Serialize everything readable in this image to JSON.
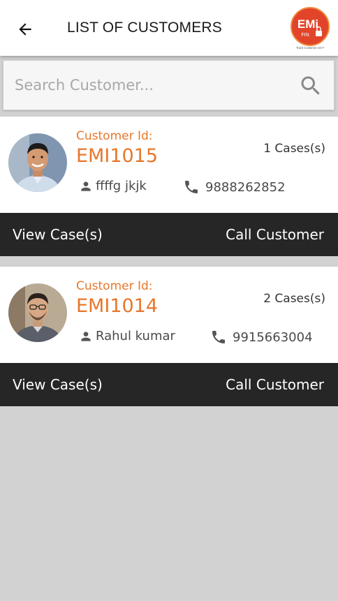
{
  "header": {
    "title": "LIST OF CUSTOMERS",
    "logo_text": "EMi",
    "logo_sub": "FIN",
    "logo_tagline": "Track Customer 24×7"
  },
  "search": {
    "placeholder": "Search Customer...",
    "value": ""
  },
  "colors": {
    "accent": "#e8772b",
    "action_bar": "#262626",
    "background": "#d2d2d2"
  },
  "customers": [
    {
      "id_label": "Customer Id:",
      "id": "EMI1015",
      "cases": "1 Cases(s)",
      "name": "ffffg jkjk",
      "phone": "9888262852",
      "view_label": "View Case(s)",
      "call_label": "Call Customer"
    },
    {
      "id_label": "Customer Id:",
      "id": "EMI1014",
      "cases": "2 Cases(s)",
      "name": "Rahul kumar",
      "phone": "9915663004",
      "view_label": "View Case(s)",
      "call_label": "Call Customer"
    }
  ]
}
